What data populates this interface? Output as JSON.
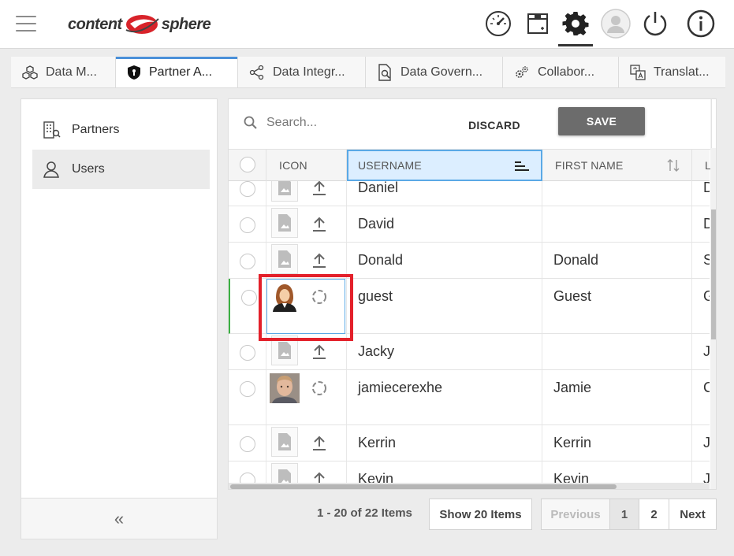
{
  "header": {
    "brand_left": "content",
    "brand_right": "sphere",
    "icons": [
      "dashboard-icon",
      "archive-box-icon",
      "settings-gear-icon",
      "user-avatar-icon",
      "power-icon",
      "info-icon"
    ]
  },
  "tabs": [
    {
      "label": "Data M...",
      "icon": "cubes-icon"
    },
    {
      "label": "Partner A...",
      "icon": "shield-icon",
      "active": true
    },
    {
      "label": "Data Integr...",
      "icon": "share-nodes-icon"
    },
    {
      "label": "Data Govern...",
      "icon": "document-search-icon"
    },
    {
      "label": "Collabor...",
      "icon": "gears-icon"
    },
    {
      "label": "Translat...",
      "icon": "translate-icon"
    }
  ],
  "sidebar": {
    "items": [
      {
        "label": "Partners",
        "icon": "building-icon"
      },
      {
        "label": "Users",
        "icon": "user-icon",
        "selected": true
      }
    ],
    "collapse_label": "«"
  },
  "toolbar": {
    "search_placeholder": "Search...",
    "discard_label": "DISCARD",
    "save_label": "SAVE"
  },
  "grid": {
    "columns": {
      "icon": "ICON",
      "username": "USERNAME",
      "first_name": "FIRST NAME"
    },
    "rows": [
      {
        "username": "Daniel",
        "first_name": "",
        "next_col": "D",
        "icon": "placeholder"
      },
      {
        "username": "David",
        "first_name": "",
        "next_col": "D",
        "icon": "placeholder"
      },
      {
        "username": "Donald",
        "first_name": "Donald",
        "next_col": "S",
        "icon": "placeholder"
      },
      {
        "username": "guest",
        "first_name": "Guest",
        "next_col": "G",
        "icon": "avatar-female"
      },
      {
        "username": "Jacky",
        "first_name": "",
        "next_col": "J",
        "icon": "placeholder"
      },
      {
        "username": "jamiecerexhe",
        "first_name": "Jamie",
        "next_col": "C",
        "icon": "avatar-male"
      },
      {
        "username": "Kerrin",
        "first_name": "Kerrin",
        "next_col": "J",
        "icon": "placeholder"
      },
      {
        "username": "Kevin",
        "first_name": "Kevin",
        "next_col": "J",
        "icon": "placeholder"
      }
    ]
  },
  "pager": {
    "info": "1 - 20 of 22 Items",
    "page_size_label": "Show 20 Items",
    "previous_label": "Previous",
    "pages": [
      "1",
      "2"
    ],
    "next_label": "Next"
  },
  "colors": {
    "accent_blue": "#4a90d9",
    "save_button": "#6c6c6c",
    "highlight_red": "#e3202a",
    "active_row_green": "#3cb043"
  }
}
